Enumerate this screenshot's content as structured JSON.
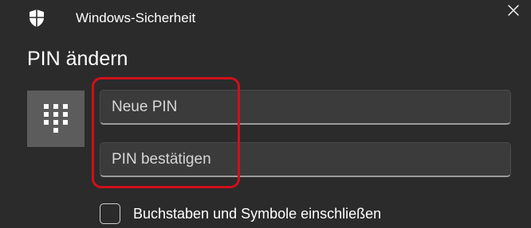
{
  "window": {
    "title": "Windows-Sicherheit",
    "app_icon": "shield-icon",
    "close_icon": "close-icon"
  },
  "page": {
    "title": "PIN ändern"
  },
  "pin_tile": {
    "icon": "keypad-icon"
  },
  "fields": {
    "new_pin": {
      "placeholder": "Neue PIN",
      "value": ""
    },
    "confirm_pin": {
      "placeholder": "PIN bestätigen",
      "value": ""
    }
  },
  "options": {
    "include_letters_symbols": {
      "label": "Buchstaben und Symbole einschließen",
      "checked": false
    }
  },
  "colors": {
    "background": "#2b2b2b",
    "field_background": "#3b3b3b",
    "tile_background": "#5c5c5c",
    "highlight": "#d0101a"
  }
}
